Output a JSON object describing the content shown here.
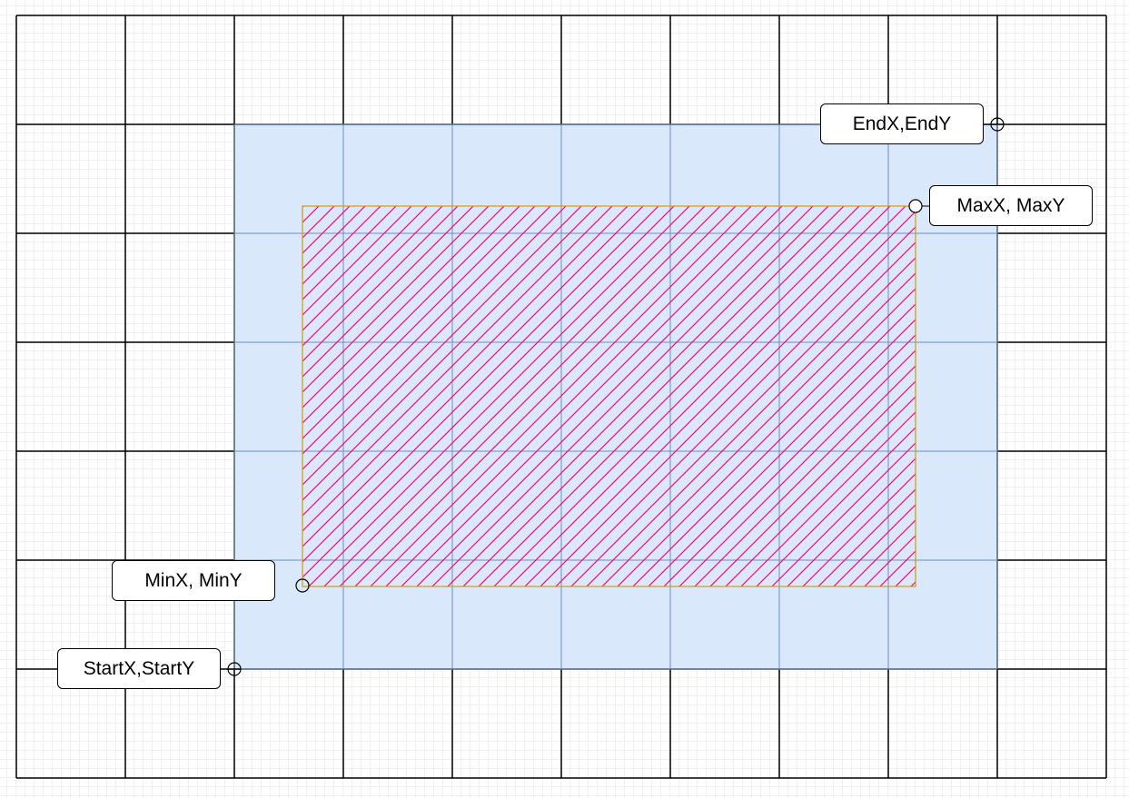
{
  "diagram": {
    "grid": {
      "columns": 10,
      "rows": 7,
      "line_color": "#000000"
    },
    "selection_area": {
      "fill_color": "#dae8fc",
      "grid_line_color": "#6c8ebf"
    },
    "hatched_area": {
      "border_color": "#d79b00",
      "hatch_color": "#ff0080"
    },
    "labels": {
      "end": "EndX,EndY",
      "max": "MaxX, MaxY",
      "min": "MinX, MinY",
      "start": "StartX,StartY"
    }
  }
}
